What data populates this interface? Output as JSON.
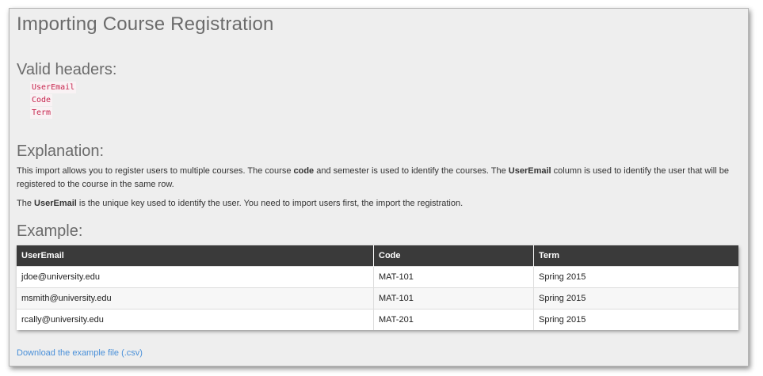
{
  "page_title": "Importing Course Registration",
  "valid_headers": {
    "heading": "Valid headers:",
    "items": [
      "UserEmail",
      "Code",
      "Term"
    ]
  },
  "explanation": {
    "heading": "Explanation:",
    "p1_a": "This import allows you to register users to multiple courses. The course ",
    "p1_b": "code",
    "p1_c": " and semester is used to identify the courses. The ",
    "p1_d": "UserEmail",
    "p1_e": " column is used to identify the user that will be registered to the course in the same row.",
    "p2_a": "The ",
    "p2_b": "UserEmail",
    "p2_c": " is the unique key used to identify the user. You need to import users first, the import the registration."
  },
  "example": {
    "heading": "Example:",
    "columns": [
      "UserEmail",
      "Code",
      "Term"
    ],
    "rows": [
      [
        "jdoe@university.edu",
        "MAT-101",
        "Spring 2015"
      ],
      [
        "msmith@university.edu",
        "MAT-101",
        "Spring 2015"
      ],
      [
        "rcally@university.edu",
        "MAT-201",
        "Spring 2015"
      ]
    ]
  },
  "download_link": "Download the example file (.csv)",
  "colors": {
    "header_bg": "#3a3a3a",
    "link": "#4a90d9",
    "code": "#c7254e"
  }
}
